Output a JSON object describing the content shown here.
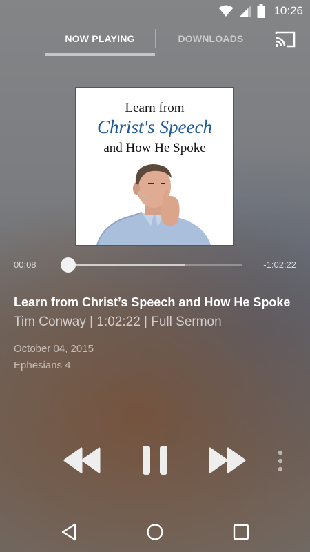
{
  "status_bar": {
    "time": "10:26",
    "icons": [
      "wifi-icon",
      "cell-signal-icon",
      "battery-icon"
    ]
  },
  "tabs": [
    {
      "label": "NOW PLAYING",
      "active": true
    },
    {
      "label": "DOWNLOADS",
      "active": false
    }
  ],
  "cast_icon": "cast-icon",
  "artwork": {
    "line1": "Learn from",
    "line2": "Christ's Speech",
    "line3": "and How He Spoke"
  },
  "player": {
    "elapsed": "00:08",
    "remaining": "-1:02:22",
    "progress_fraction": 0.003,
    "buffered_fraction": 0.67
  },
  "sermon": {
    "title": "Learn from Christ’s Speech and How He Spoke",
    "subtitle": "Tim Conway | 1:02:22 | Full Sermon",
    "date": "October 04, 2015",
    "scripture": "Ephesians 4"
  },
  "controls": [
    "rewind-icon",
    "pause-icon",
    "fast-forward-icon",
    "more-vert-icon"
  ],
  "nav_bar": [
    "back-icon",
    "home-icon",
    "recents-icon"
  ],
  "colors": {
    "artwork_border": "#355d89",
    "artwork_title_accent": "#1f5a99"
  }
}
